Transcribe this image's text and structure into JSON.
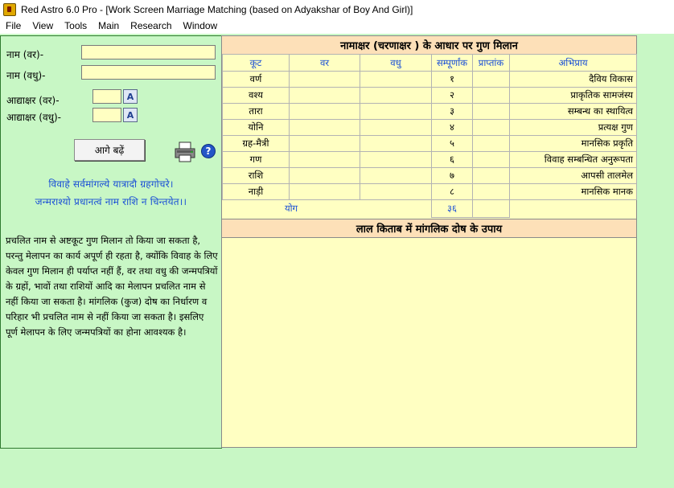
{
  "window": {
    "title": "Red Astro 6.0 Pro - [Work Screen Marriage Matching (based on Adyakshar of Boy And Girl)]"
  },
  "menu": [
    "File",
    "View",
    "Tools",
    "Main",
    "Research",
    "Window"
  ],
  "form": {
    "groom_name_label": "नाम (वर)-",
    "groom_name_value": "",
    "bride_name_label": "नाम (वधु)-",
    "bride_name_value": "",
    "groom_initial_label": "आद्याक्षर (वर)-",
    "groom_initial_value": "",
    "bride_initial_label": "आद्याक्षर (वधु)-",
    "bride_initial_value": "",
    "letter_button_label": "A",
    "next_button_label": "आगे बढ़ें",
    "help_label": "?"
  },
  "shloka": {
    "line1": "विवाहे सर्वमांगल्ये यात्रादौ ग्रहगोचरे।",
    "line2": "जन्मराश्यो प्रधानत्वं नाम राशि न चिन्तयेत।।"
  },
  "description": "प्रचलित नाम से अष्टकूट गुण मिलान तो किया जा सकता है, परन्तु मेलापन का कार्य अपूर्ण ही रहता है, क्योंकि विवाह के लिए केवल गुण मिलान ही पर्याप्त नहीं हैं, वर तथा वधु की जन्मपत्रियों के ग्रहों, भावों तथा राशियों आदि का मेलापन प्रचलित नाम से नहीं किया जा सकता है। मांगलिक (कुज) दोष का निर्धारण व परिहार भी प्रचलित नाम से नहीं किया जा सकता है। इसलिए पूर्ण मेलापन के लिए जन्मपत्रियों का होना आवश्यक है।",
  "matching": {
    "title": "नामाक्षर (चरणाक्षर ) के आधार पर गुण मिलान",
    "columns": [
      "कूट",
      "वर",
      "वधु",
      "सम्पूर्णांक",
      "प्राप्तांक",
      "अभिप्राय"
    ],
    "rows": [
      {
        "koot": "वर्ण",
        "var": "",
        "vadhu": "",
        "total": "१",
        "obtained": "",
        "meaning": "दैविय विकास"
      },
      {
        "koot": "वश्य",
        "var": "",
        "vadhu": "",
        "total": "२",
        "obtained": "",
        "meaning": "प्राकृतिक सामजंस्य"
      },
      {
        "koot": "तारा",
        "var": "",
        "vadhu": "",
        "total": "३",
        "obtained": "",
        "meaning": "सम्बन्ध का स्थायित्व"
      },
      {
        "koot": "योनि",
        "var": "",
        "vadhu": "",
        "total": "४",
        "obtained": "",
        "meaning": "प्रत्यक्ष गुण"
      },
      {
        "koot": "ग्रह-मैत्री",
        "var": "",
        "vadhu": "",
        "total": "५",
        "obtained": "",
        "meaning": "मानसिक प्रकृति"
      },
      {
        "koot": "गण",
        "var": "",
        "vadhu": "",
        "total": "६",
        "obtained": "",
        "meaning": "विवाह सम्बन्धित अनुरूपता"
      },
      {
        "koot": "राशि",
        "var": "",
        "vadhu": "",
        "total": "७",
        "obtained": "",
        "meaning": "आपसी तालमेल"
      },
      {
        "koot": "नाड़ी",
        "var": "",
        "vadhu": "",
        "total": "८",
        "obtained": "",
        "meaning": "मानसिक मानक"
      }
    ],
    "total_label": "योग",
    "total_value": "३६",
    "total_obtained": ""
  },
  "remedy": {
    "title": "लाल किताब में मांगलिक दोष के उपाय"
  }
}
